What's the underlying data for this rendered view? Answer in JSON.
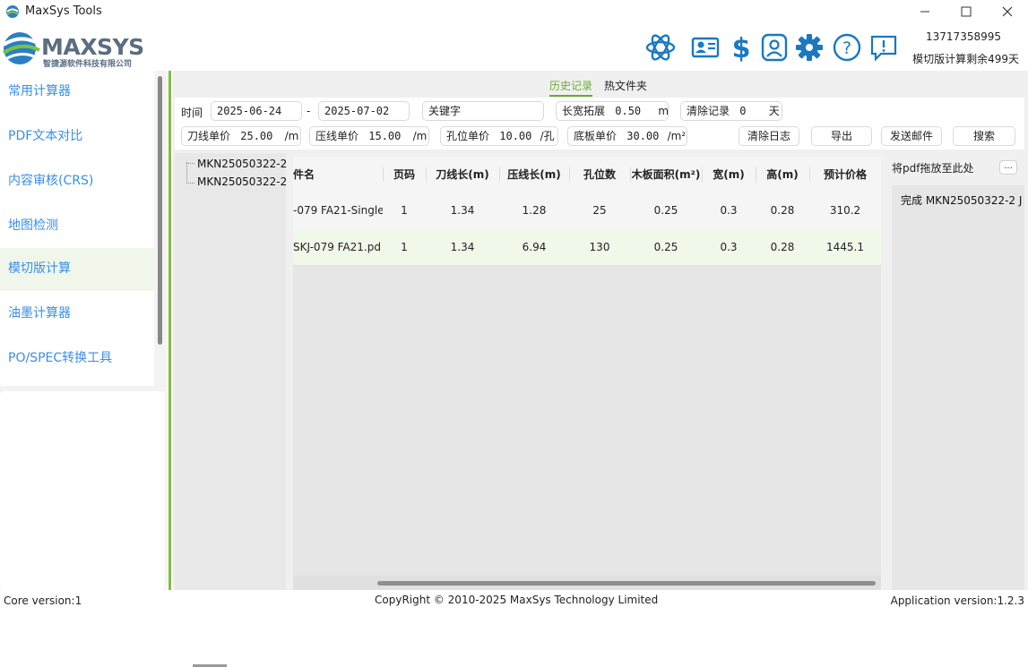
{
  "window": {
    "title": "MaxSys Tools"
  },
  "header": {
    "logo_text": "MAXSYS",
    "logo_sub": "智捷源软件科技有限公司",
    "phone": "13717358995",
    "remaining": "模切版计算剩余499天"
  },
  "sidebar": {
    "items": [
      {
        "label": "常用计算器"
      },
      {
        "label": "PDF文本对比"
      },
      {
        "label": "内容审核(CRS)"
      },
      {
        "label": "地图检测"
      },
      {
        "label": "模切版计算"
      },
      {
        "label": "油墨计算器"
      },
      {
        "label": "PO/SPEC转换工具"
      }
    ],
    "active_index": 4
  },
  "tabs": {
    "history": "历史记录",
    "hot_folder": "热文件夹"
  },
  "filter": {
    "time_label": "时间",
    "date_from": "2025-06-24",
    "dash": "-",
    "date_to": "2025-07-02",
    "keyword_placeholder": "关键字",
    "expand_label": "长宽拓展",
    "expand_value": "0.50",
    "expand_unit": "m",
    "clear_record_label": "清除记录",
    "clear_record_value": "0",
    "clear_record_unit": "天",
    "knife_label": "刀线单价",
    "knife_value": "25.00",
    "knife_unit": "/m",
    "press_label": "压线单价",
    "press_value": "15.00",
    "press_unit": "/m",
    "hole_label": "孔位单价",
    "hole_value": "10.00",
    "hole_unit": "/孔",
    "base_label": "底板单价",
    "base_value": "30.00",
    "base_unit": "/m²",
    "clear_log": "清除日志",
    "export": "导出",
    "send_mail": "发送邮件",
    "search": "搜索"
  },
  "tree": {
    "nodes": [
      "MKN25050322-2",
      "MKN25050322-2"
    ]
  },
  "table": {
    "headers": [
      "件名",
      "页码",
      "刀线长(m)",
      "压线长(m)",
      "孔位数",
      "木板面积(m²)",
      "宽(m)",
      "高(m)",
      "预计价格"
    ],
    "rows": [
      [
        "-079 FA21-Single",
        "1",
        "1.34",
        "1.28",
        "25",
        "0.25",
        "0.3",
        "0.28",
        "310.2"
      ],
      [
        "SKJ-079 FA21.pd",
        "1",
        "1.34",
        "6.94",
        "130",
        "0.25",
        "0.3",
        "0.28",
        "1445.1"
      ]
    ]
  },
  "right_panel": {
    "drop_label": "将pdf拖放至此处",
    "more": "...",
    "done": "完成 MKN25050322-2 J"
  },
  "status": {
    "core": "Core version:1",
    "copyright": "CopyRight ©  2010-2025 MaxSys Technology Limited",
    "app": "Application version:1.2.3"
  },
  "colors": {
    "accent_green": "#7cc142",
    "link_blue": "#3a8ee6",
    "icon_blue": "#1a78c2"
  }
}
